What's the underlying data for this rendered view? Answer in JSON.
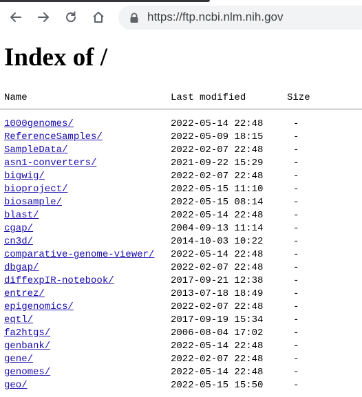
{
  "browser": {
    "url": "https://ftp.ncbi.nlm.nih.gov"
  },
  "page": {
    "title": "Index of /",
    "columns": {
      "name": "Name",
      "modified": "Last modified",
      "size": "Size"
    },
    "entries": [
      {
        "name": "1000genomes/",
        "modified": "2022-05-14 22:48",
        "size": "-"
      },
      {
        "name": "ReferenceSamples/",
        "modified": "2022-05-09 18:15",
        "size": "-"
      },
      {
        "name": "SampleData/",
        "modified": "2022-02-07 22:48",
        "size": "-"
      },
      {
        "name": "asn1-converters/",
        "modified": "2021-09-22 15:29",
        "size": "-"
      },
      {
        "name": "bigwig/",
        "modified": "2022-02-07 22:48",
        "size": "-"
      },
      {
        "name": "bioproject/",
        "modified": "2022-05-15 11:10",
        "size": "-"
      },
      {
        "name": "biosample/",
        "modified": "2022-05-15 08:14",
        "size": "-"
      },
      {
        "name": "blast/",
        "modified": "2022-05-14 22:48",
        "size": "-"
      },
      {
        "name": "cgap/",
        "modified": "2004-09-13 11:14",
        "size": "-"
      },
      {
        "name": "cn3d/",
        "modified": "2014-10-03 10:22",
        "size": "-"
      },
      {
        "name": "comparative-genome-viewer/",
        "modified": "2022-05-14 22:48",
        "size": "-"
      },
      {
        "name": "dbgap/",
        "modified": "2022-02-07 22:48",
        "size": "-"
      },
      {
        "name": "diffexpIR-notebook/",
        "modified": "2017-09-21 12:38",
        "size": "-"
      },
      {
        "name": "entrez/",
        "modified": "2013-07-18 18:49",
        "size": "-"
      },
      {
        "name": "epigenomics/",
        "modified": "2022-02-07 22:48",
        "size": "-"
      },
      {
        "name": "eqtl/",
        "modified": "2017-09-19 15:34",
        "size": "-"
      },
      {
        "name": "fa2htgs/",
        "modified": "2006-08-04 17:02",
        "size": "-"
      },
      {
        "name": "genbank/",
        "modified": "2022-05-14 22:48",
        "size": "-"
      },
      {
        "name": "gene/",
        "modified": "2022-02-07 22:48",
        "size": "-"
      },
      {
        "name": "genomes/",
        "modified": "2022-05-14 22:48",
        "size": "-"
      },
      {
        "name": "geo/",
        "modified": "2022-05-15 15:50",
        "size": "-"
      }
    ]
  }
}
